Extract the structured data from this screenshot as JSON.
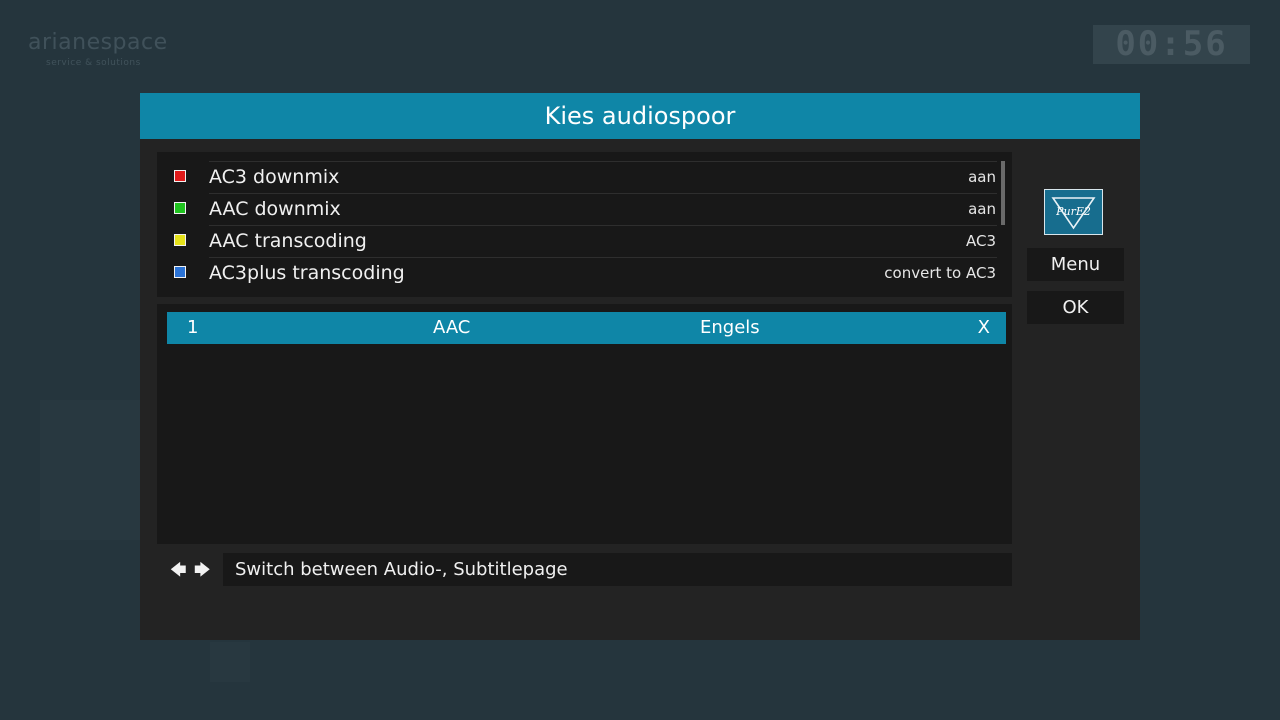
{
  "background": {
    "logo_text": "arianespace",
    "logo_sub": "service & solutions",
    "clock": "00:56"
  },
  "dialog": {
    "title": "Kies audiospoor",
    "options": [
      {
        "label": "AC3 downmix",
        "value": "aan",
        "color": "#e01b1b"
      },
      {
        "label": "AAC downmix",
        "value": "aan",
        "color": "#1fc41f"
      },
      {
        "label": "AAC transcoding",
        "value": "AC3",
        "color": "#e6e21a"
      },
      {
        "label": "AC3plus transcoding",
        "value": "convert to AC3",
        "color": "#2b73d6"
      }
    ],
    "tracks": [
      {
        "number": "1",
        "codec": "AAC",
        "language": "Engels",
        "selected": "X"
      }
    ],
    "help": {
      "left_arrow": "🡄",
      "right_arrow": "🡆",
      "text": "Switch between Audio-, Subtitlepage"
    },
    "buttons": {
      "menu": "Menu",
      "ok": "OK"
    },
    "logo_text": "PurE2"
  },
  "colors": {
    "accent": "#0f86a7",
    "panel": "#181818",
    "dialog_bg": "#232323",
    "screen_bg": "#25353d"
  }
}
